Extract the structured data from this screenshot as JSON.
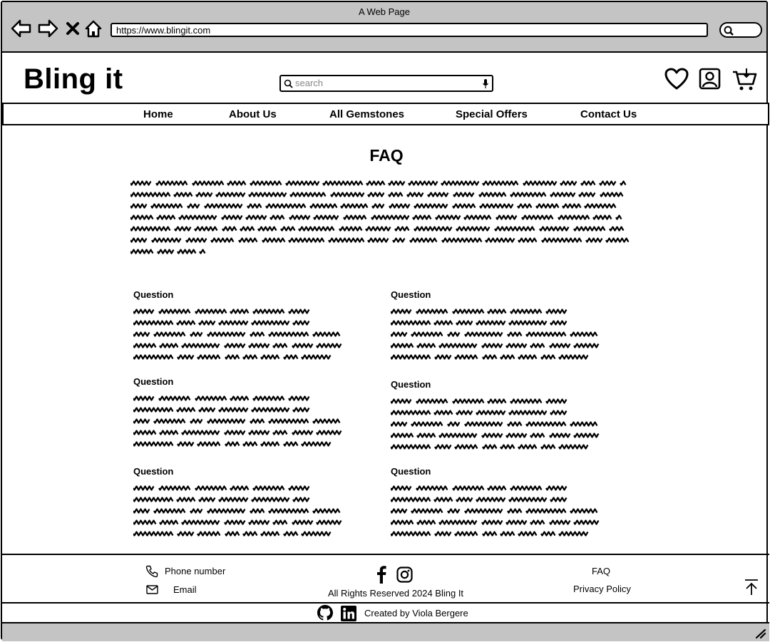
{
  "browser": {
    "window_title": "A Web Page",
    "url": "https://www.blingit.com"
  },
  "header": {
    "logo": "Bling it",
    "search_placeholder": "search"
  },
  "nav": {
    "items": [
      "Home",
      "About Us",
      "All Gemstones",
      "Special Offers",
      "Contact Us"
    ]
  },
  "main": {
    "title": "FAQ",
    "questions": [
      {
        "title": "Question"
      },
      {
        "title": "Question"
      },
      {
        "title": "Question"
      },
      {
        "title": "Question"
      },
      {
        "title": "Question"
      },
      {
        "title": "Question"
      }
    ]
  },
  "footer": {
    "phone_label": "Phone number",
    "email_label": "Email",
    "copyright": "All Rights Reserved 2024 Bling It",
    "faq_link": "FAQ",
    "privacy_link": "Privacy Policy",
    "credit": "Created by Viola Bergere"
  },
  "icons": [
    "back-arrow-icon",
    "forward-arrow-icon",
    "close-icon",
    "home-icon",
    "search-icon",
    "microphone-icon",
    "heart-icon",
    "user-icon",
    "cart-icon",
    "phone-icon",
    "mail-icon",
    "facebook-icon",
    "instagram-icon",
    "back-to-top-icon",
    "github-icon",
    "linkedin-icon",
    "resize-grip-icon"
  ]
}
